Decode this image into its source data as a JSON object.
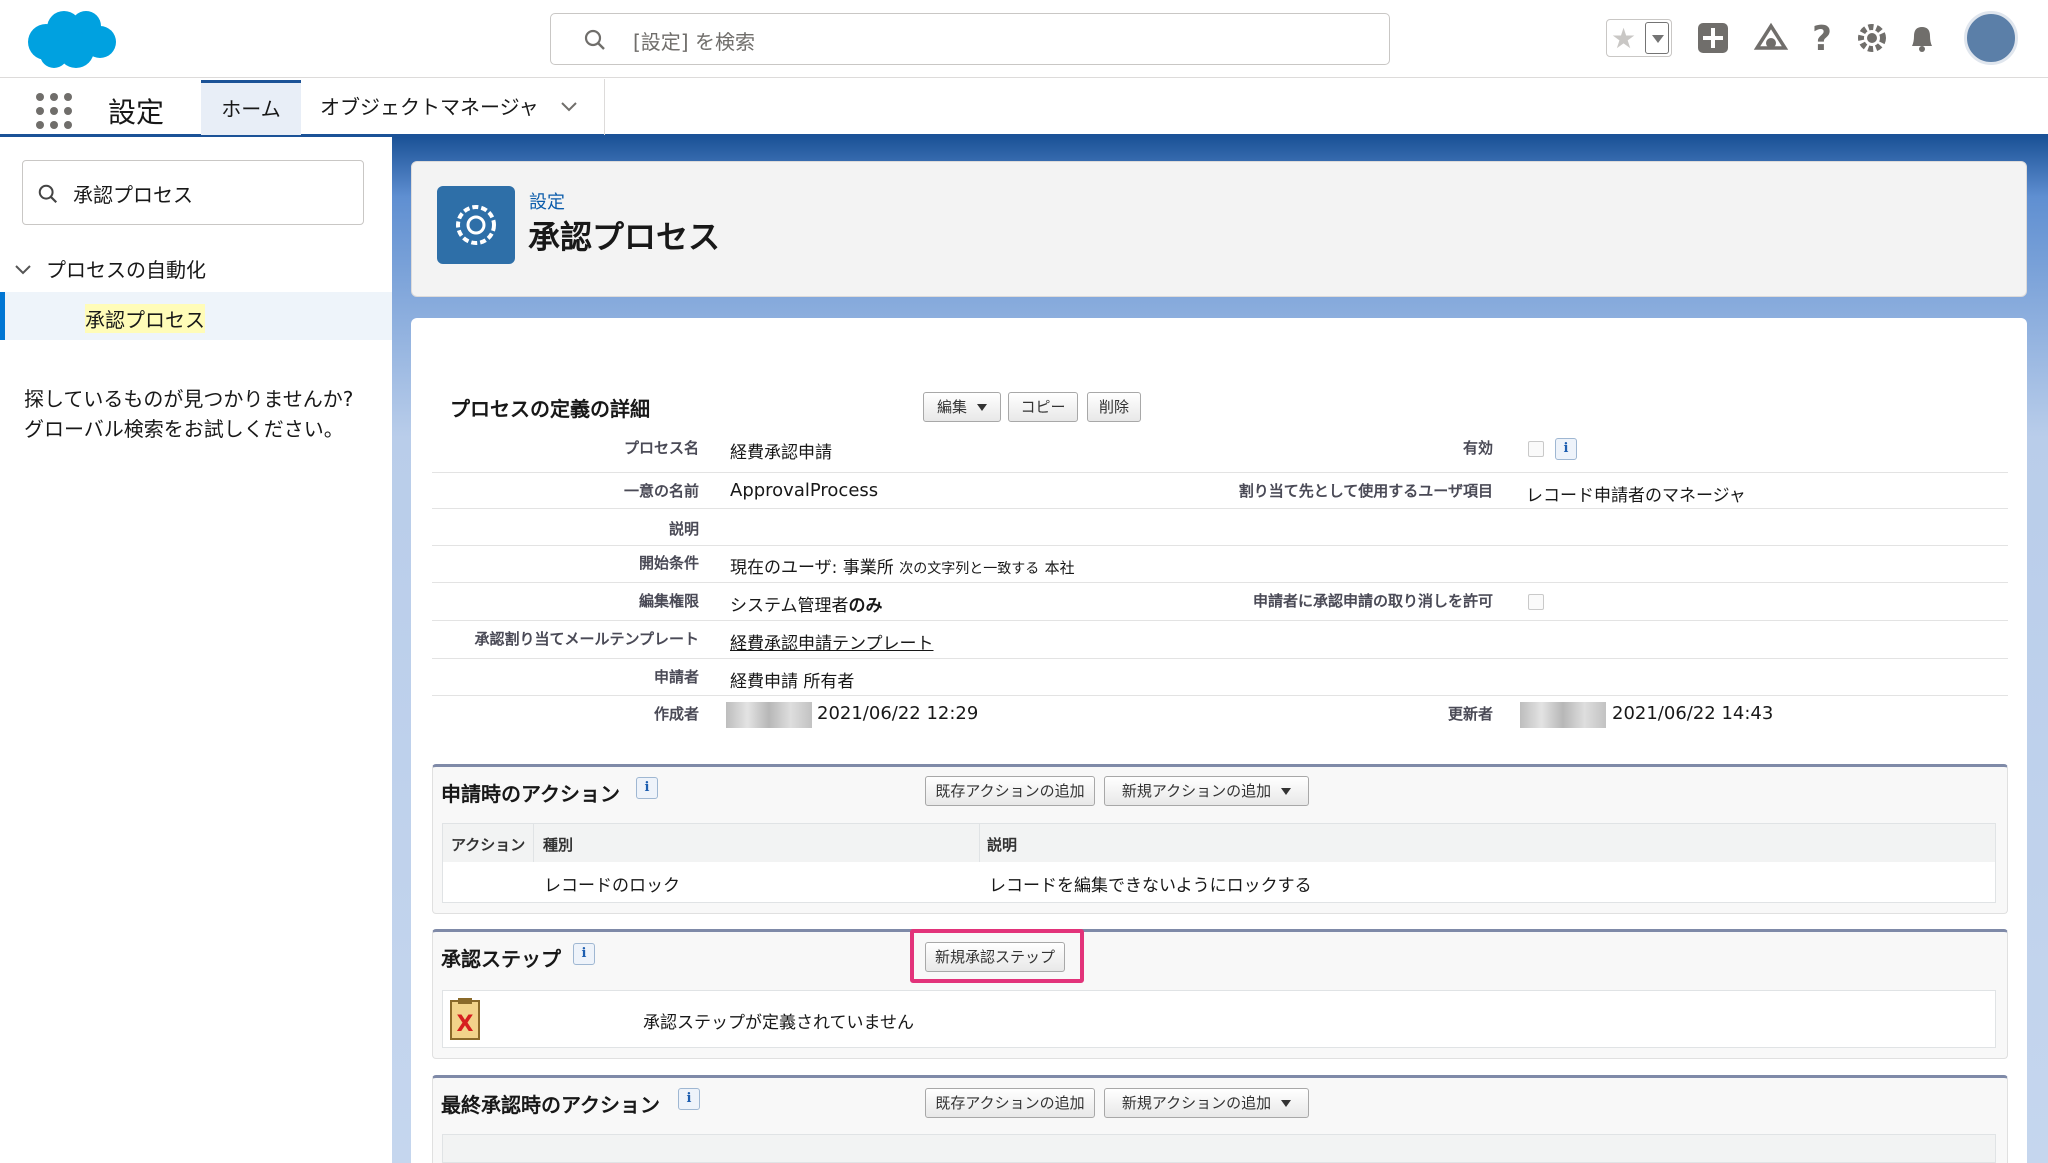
{
  "header": {
    "search_placeholder": "[設定] を検索",
    "icons": [
      "star-icon",
      "add-icon",
      "trailhead-icon",
      "help-icon",
      "setup-gear-icon",
      "notification-bell-icon"
    ]
  },
  "nav": {
    "app_name": "設定",
    "tabs": [
      {
        "label": "ホーム",
        "active": true
      },
      {
        "label": "オブジェクトマネージャ",
        "active": false
      }
    ]
  },
  "sidebar": {
    "quick_find_value": "承認プロセス",
    "tree_parent": "プロセスの自動化",
    "tree_selected": "承認プロセス",
    "help_line1": "探しているものが見つかりませんか?",
    "help_line2": "グローバル検索をお試しください。"
  },
  "page_header": {
    "breadcrumb": "設定",
    "title": "承認プロセス"
  },
  "detail": {
    "section_title": "プロセスの定義の詳細",
    "buttons": {
      "edit": "編集",
      "copy": "コピー",
      "delete": "削除"
    },
    "fields": {
      "process_name_label": "プロセス名",
      "process_name": "経費承認申請",
      "active_label": "有効",
      "unique_name_label": "一意の名前",
      "unique_name": "ApprovalProcess",
      "assignee_field_label": "割り当て先として使用するユーザ項目",
      "assignee_field": "レコード申請者のマネージャ",
      "description_label": "説明",
      "entry_criteria_label": "開始条件",
      "entry_criteria_a": "現在のユーザ: 事業所",
      "entry_criteria_b": "次の文字列と一致する",
      "entry_criteria_c": "本社",
      "edit_permission_label": "編集権限",
      "edit_permission_a": "システム管理者",
      "edit_permission_b": "のみ",
      "recall_label": "申請者に承認申請の取り消しを許可",
      "email_template_label": "承認割り当てメールテンプレート",
      "email_template": "経費承認申請テンプレート",
      "submitter_label": "申請者",
      "submitter": "経費申請 所有者",
      "created_by_label": "作成者",
      "created_date": "2021/06/22 12:29",
      "modified_by_label": "更新者",
      "modified_date": "2021/06/22 14:43"
    }
  },
  "initial_submission": {
    "title": "申請時のアクション",
    "add_existing": "既存アクションの追加",
    "add_new": "新規アクションの追加",
    "columns": [
      "アクション",
      "種別",
      "説明"
    ],
    "rows": [
      {
        "type": "レコードのロック",
        "description": "レコードを編集できないようにロックする"
      }
    ]
  },
  "approval_steps": {
    "title": "承認ステップ",
    "new_step": "新規承認ステップ",
    "empty_message": "承認ステップが定義されていません"
  },
  "final_approval": {
    "title": "最終承認時のアクション",
    "add_existing": "既存アクションの追加",
    "add_new": "新規アクションの追加"
  },
  "colors": {
    "brand_blue": "#1b5297",
    "highlight_pink": "#e2337a",
    "selected_bg": "#eef4fa"
  }
}
